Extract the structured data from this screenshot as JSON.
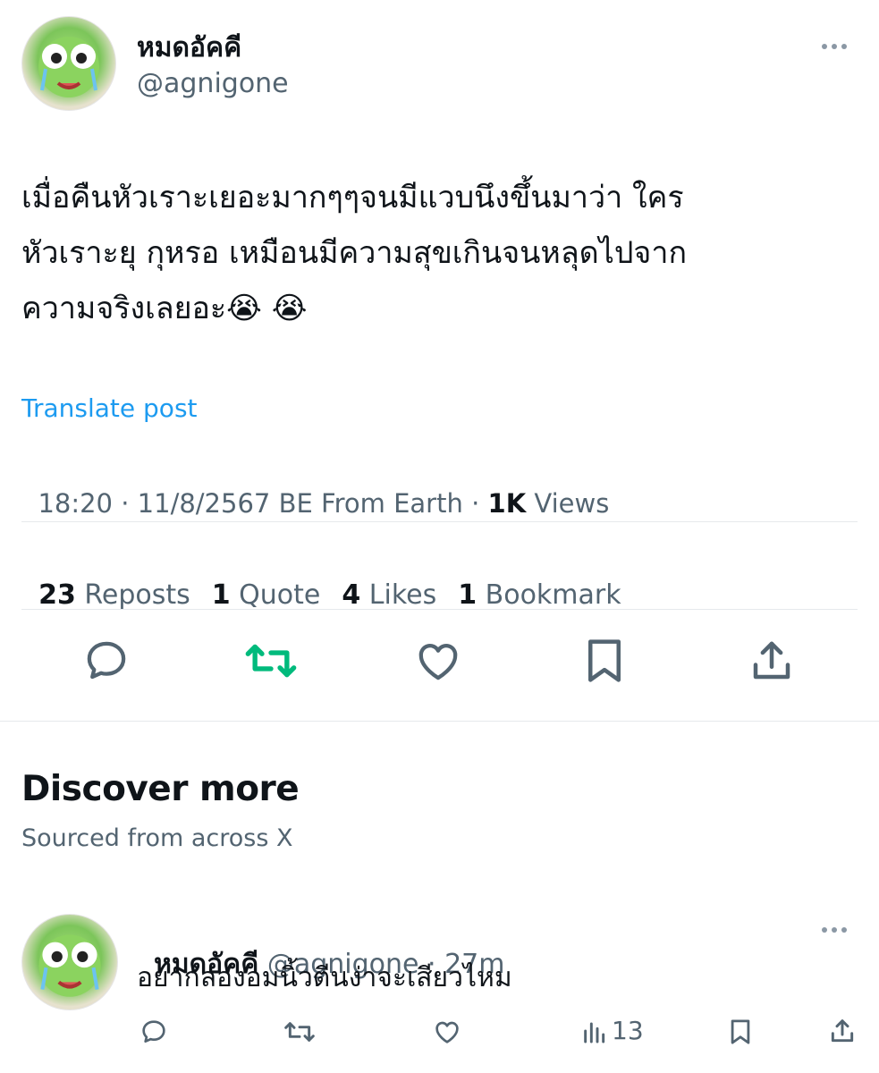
{
  "post": {
    "display_name": "หมดอัคคี",
    "handle": "@agnigone",
    "text_line1": "เมื่อคืนหัวเราะเยอะมากๆๆจนมีแวบนึงขึ้นมาว่า ใคร",
    "text_line2": "หัวเราะยุ กุหรอ เหมือนมีความสุขเกินจนหลุดไปจาก",
    "text_line3": "ความจริงเลยอะ😭 😭",
    "translate_label": "Translate post",
    "meta_time": "18:20 · 11/8/2567 BE From Earth · ",
    "views_count": "1K",
    "views_label": " Views",
    "stats": [
      {
        "count": "23",
        "label": " Reposts"
      },
      {
        "count": "1",
        "label": " Quote"
      },
      {
        "count": "4",
        "label": " Likes"
      },
      {
        "count": "1",
        "label": " Bookmark"
      }
    ],
    "actions": [
      "reply-icon",
      "repost-icon",
      "like-icon",
      "bookmark-icon",
      "share-icon"
    ]
  },
  "discover": {
    "title": "Discover more",
    "subtitle": "Sourced from across X"
  },
  "reply": {
    "display_name": "หมดอัคคี",
    "handle": "@agnigone",
    "time": " · 27m",
    "text": "อยากลองอมนิ้วตีนง่าจะเสียวไหม",
    "views": "13"
  },
  "colors": {
    "accent_blue": "#1d9bf0",
    "repost_green": "#00ba7c",
    "muted": "#536471"
  }
}
